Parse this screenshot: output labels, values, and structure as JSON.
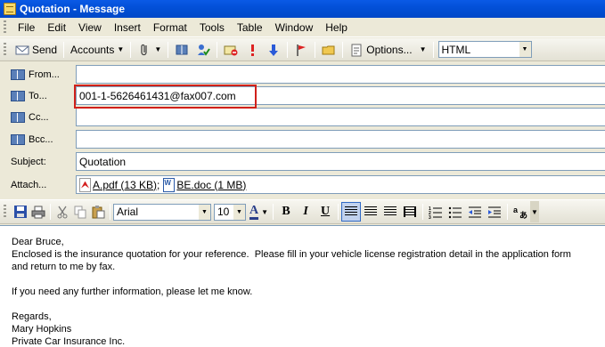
{
  "window": {
    "title": "Quotation - Message"
  },
  "menu": [
    "File",
    "Edit",
    "View",
    "Insert",
    "Format",
    "Tools",
    "Table",
    "Window",
    "Help"
  ],
  "toolbar": {
    "send_label": "Send",
    "accounts_label": "Accounts",
    "options_label": "Options...",
    "format_value": "HTML"
  },
  "headers": {
    "from_label": "From...",
    "to_label": "To...",
    "cc_label": "Cc...",
    "bcc_label": "Bcc...",
    "subject_label": "Subject:",
    "attach_label": "Attach...",
    "from_value": "",
    "to_value": "001-1-5626461431@fax007.com",
    "cc_value": "",
    "bcc_value": "",
    "subject_value": "Quotation",
    "attachments": [
      {
        "name": "A.pdf (13 KB)",
        "type": "pdf-icon",
        "separator": ";"
      },
      {
        "name": "BE.doc (1 MB)",
        "type": "word-doc-icon",
        "separator": ""
      }
    ]
  },
  "format_toolbar": {
    "font": "Arial",
    "size": "10",
    "bold": "B",
    "italic": "I",
    "underline": "U",
    "font_color": "A"
  },
  "body": {
    "lines": [
      "Dear Bruce,",
      "Enclosed is the insurance quotation for your reference.  Please fill in your vehicle license registration detail in the application form",
      "and return to me by fax.",
      "",
      "If you need any further information, please let me know.",
      "",
      "Regards,",
      "Mary Hopkins",
      "Private Car Insurance Inc."
    ]
  },
  "colors": {
    "titlebar": "#0350d8",
    "highlight_box": "#d0201a",
    "field_border": "#7f9db9"
  }
}
